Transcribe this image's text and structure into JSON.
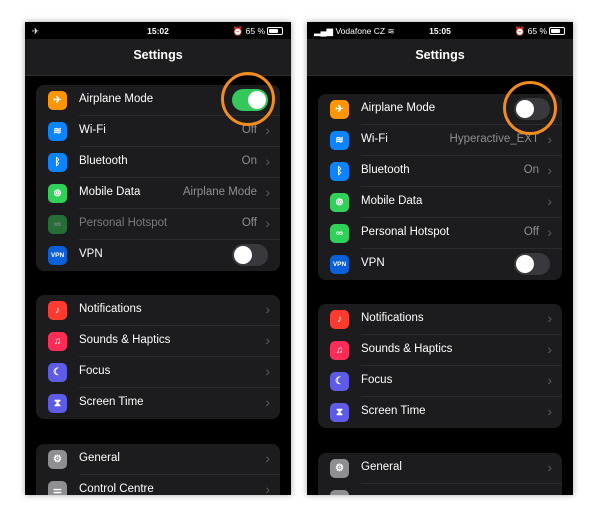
{
  "colors": {
    "accent_ring": "#f28c1e",
    "toggle_on": "#34c759",
    "toggle_off": "#39393d",
    "airplane": "#ff9500",
    "wifi": "#0a84ff",
    "bluetooth": "#0a84ff",
    "mobile_data": "#30d158",
    "hotspot": "#30d158",
    "vpn": "#0a60d8",
    "notifications": "#ff3b30",
    "sounds": "#ff2d55",
    "focus": "#5e5ce6",
    "screen_time": "#5e5ce6",
    "general": "#8e8e93"
  },
  "left": {
    "status": {
      "left_text": "✈",
      "time": "15:02",
      "battery": "65 %"
    },
    "title": "Settings",
    "group1": [
      {
        "icon": "airplane-icon",
        "glyph": "✈",
        "label": "Airplane Mode",
        "toggle": "on"
      },
      {
        "icon": "wifi-icon",
        "glyph": "≋",
        "label": "Wi-Fi",
        "value": "Off"
      },
      {
        "icon": "bluetooth-icon",
        "glyph": "ᛒ",
        "label": "Bluetooth",
        "value": "On"
      },
      {
        "icon": "antenna-icon",
        "glyph": "⊚",
        "label": "Mobile Data",
        "value": "Airplane Mode"
      },
      {
        "icon": "hotspot-icon",
        "glyph": "∞",
        "label": "Personal Hotspot",
        "value": "Off"
      },
      {
        "icon": "vpn-icon",
        "glyph": "VPN",
        "label": "VPN",
        "toggle": "off"
      }
    ],
    "group2": [
      {
        "icon": "bell-icon",
        "glyph": "♪",
        "label": "Notifications"
      },
      {
        "icon": "speaker-icon",
        "glyph": "♫",
        "label": "Sounds & Haptics"
      },
      {
        "icon": "moon-icon",
        "glyph": "☾",
        "label": "Focus"
      },
      {
        "icon": "hourglass-icon",
        "glyph": "⧗",
        "label": "Screen Time"
      }
    ],
    "group3": [
      {
        "icon": "gear-icon",
        "glyph": "⚙",
        "label": "General"
      },
      {
        "icon": "switches-icon",
        "glyph": "⚌",
        "label": "Control Centre"
      }
    ]
  },
  "right": {
    "status": {
      "left_text": "Vodafone CZ",
      "time": "15:05",
      "battery": "65 %"
    },
    "title": "Settings",
    "group1": [
      {
        "icon": "airplane-icon",
        "glyph": "✈",
        "label": "Airplane Mode",
        "toggle": "off"
      },
      {
        "icon": "wifi-icon",
        "glyph": "≋",
        "label": "Wi-Fi",
        "value": "Hyperactive_EXT"
      },
      {
        "icon": "bluetooth-icon",
        "glyph": "ᛒ",
        "label": "Bluetooth",
        "value": "On"
      },
      {
        "icon": "antenna-icon",
        "glyph": "⊚",
        "label": "Mobile Data",
        "value": ""
      },
      {
        "icon": "hotspot-icon",
        "glyph": "∞",
        "label": "Personal Hotspot",
        "value": "Off"
      },
      {
        "icon": "vpn-icon",
        "glyph": "VPN",
        "label": "VPN",
        "toggle": "off"
      }
    ],
    "group2": [
      {
        "icon": "bell-icon",
        "glyph": "♪",
        "label": "Notifications"
      },
      {
        "icon": "speaker-icon",
        "glyph": "♫",
        "label": "Sounds & Haptics"
      },
      {
        "icon": "moon-icon",
        "glyph": "☾",
        "label": "Focus"
      },
      {
        "icon": "hourglass-icon",
        "glyph": "⧗",
        "label": "Screen Time"
      }
    ],
    "group3": [
      {
        "icon": "gear-icon",
        "glyph": "⚙",
        "label": "General"
      },
      {
        "icon": "switches-icon",
        "glyph": "",
        "label": ""
      }
    ]
  }
}
